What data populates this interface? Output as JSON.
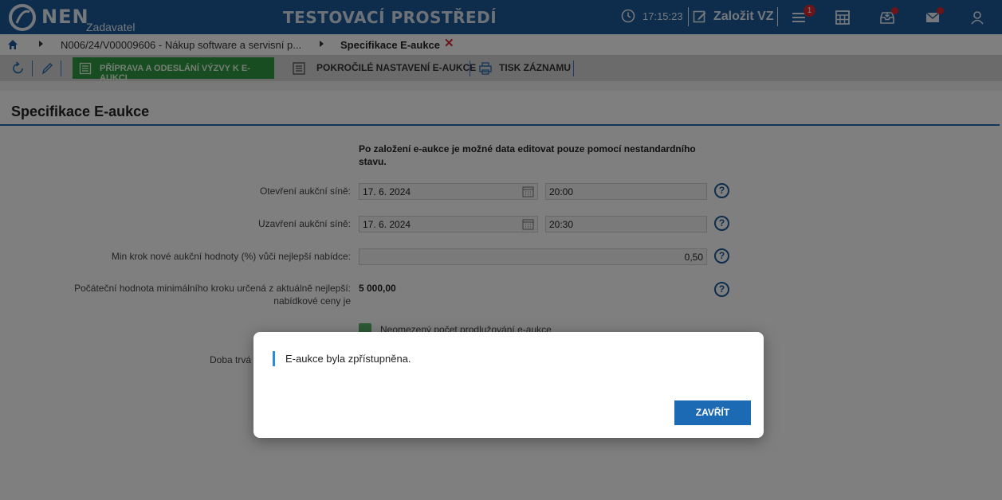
{
  "header": {
    "brand": "NEN",
    "brand_sub": "Zadavatel",
    "environment": "TESTOVACÍ PROSTŘEDÍ",
    "time": "17:15:23",
    "create_label": "Založit VZ",
    "menu_badge": "1"
  },
  "breadcrumb": {
    "item1": "N006/24/V00009606 - Nákup software a servisní p...",
    "item2": "Specifikace E-aukce",
    "close": "✕"
  },
  "toolbar": {
    "primary": "PŘÍPRAVA A ODESLÁNÍ VÝZVY K E-AUKCI",
    "advanced": "POKROČILÉ NASTAVENÍ E-AUKCE",
    "print": "TISK ZÁZNAMU"
  },
  "page": {
    "title": "Specifikace E-aukce",
    "note": "Po založení e-aukce je možné data editovat pouze pomocí nestandardního stavu.",
    "fields": {
      "open_label": "Otevření aukční síně:",
      "open_date": "17. 6. 2024",
      "open_time": "20:00",
      "close_label": "Uzavření aukční síně:",
      "close_date": "17. 6. 2024",
      "close_time": "20:30",
      "min_step_label": "Min krok nové aukční hodnoty (%) vůči nejlepší nabídce:",
      "min_step_value": "0,50",
      "initial_label": "Počáteční hodnota minimálního kroku určená z aktuálně nejlepší: nabídkové ceny je",
      "initial_value": "5 000,00",
      "unlimited_label": "Neomezený počet prodlužování e-aukce",
      "duration_label": "Doba trvá"
    },
    "help": "?"
  },
  "dialog": {
    "message": "E-aukce byla zpřístupněna.",
    "close_button": "ZAVŘÍT"
  },
  "colors": {
    "header": "#1c5a99",
    "primary_green": "#2f9a41",
    "accent_blue": "#1c6ab4",
    "badge_red": "#d9292f"
  },
  "icons": [
    "nen-logo-icon",
    "clock-icon",
    "edit-icon",
    "menu-icon",
    "calculator-icon",
    "inbox-icon",
    "mail-icon",
    "user-icon",
    "home-icon",
    "refresh-icon",
    "pencil-icon",
    "document-icon",
    "print-icon",
    "calendar-icon",
    "help-icon",
    "checkbox-icon"
  ]
}
